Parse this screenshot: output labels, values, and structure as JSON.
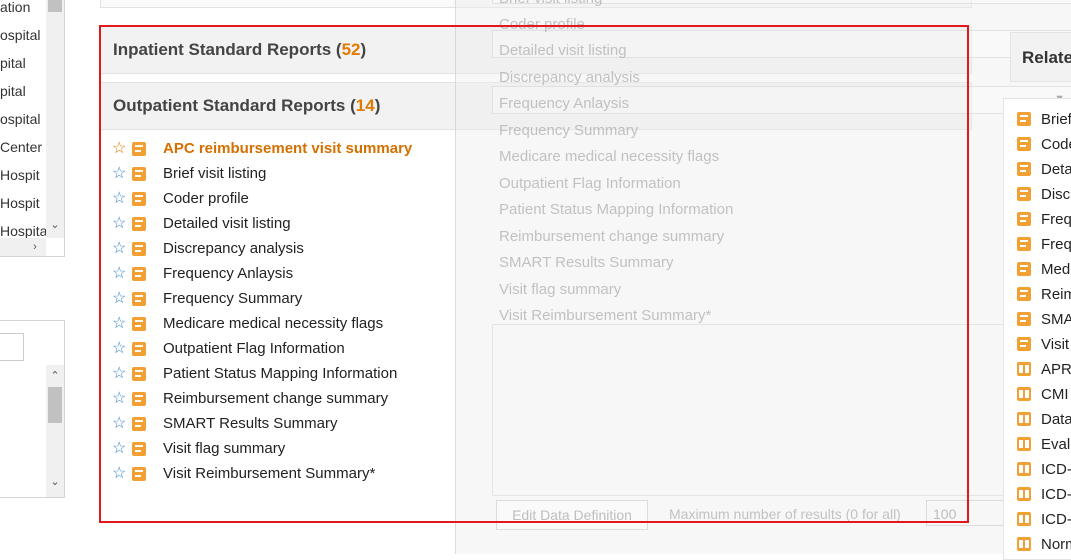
{
  "sidebar": {
    "facility_items": [
      "ation",
      "ospital",
      "pital",
      "pital",
      "ospital",
      "Center",
      "Hospit",
      "Hospit",
      "Hospita"
    ]
  },
  "main": {
    "sections": [
      {
        "label": "Inpatient Standard Reports",
        "count": "52",
        "state": "collapsed"
      },
      {
        "label": "Outpatient Standard Reports",
        "count": "14",
        "state": "expanded"
      }
    ],
    "reports": [
      "APC reimbursement visit summary",
      "Brief visit listing",
      "Coder profile",
      "Detailed visit listing",
      "Discrepancy analysis",
      "Frequency Anlaysis",
      "Frequency Summary",
      "Medicare medical necessity flags",
      "Outpatient Flag Information",
      "Patient Status Mapping Information",
      "Reimbursement change summary",
      "SMART Results Summary",
      "Visit flag summary",
      "Visit Reimbursement Summary*"
    ],
    "selected_index": 0
  },
  "ghost": {
    "items": [
      "Brief visit listing",
      "Coder profile",
      "Detailed visit listing",
      "Discrepancy analysis",
      "Frequency Anlaysis",
      "Frequency Summary",
      "Medicare medical necessity flags",
      "Outpatient Flag Information",
      "Patient Status Mapping Information",
      "Reimbursement change summary",
      "SMART Results Summary",
      "Visit flag summary",
      "Visit Reimbursement Summary*"
    ],
    "edit_button": "Edit Data Definition",
    "max_label": "Maximum number of results (0 for all)",
    "max_value": "100"
  },
  "related": {
    "title": "Relate",
    "items": [
      {
        "label": "Brief",
        "icon": "report-icon"
      },
      {
        "label": "Code",
        "icon": "report-icon"
      },
      {
        "label": "Deta",
        "icon": "report-icon"
      },
      {
        "label": "Disc",
        "icon": "report-icon"
      },
      {
        "label": "Freq",
        "icon": "report-icon"
      },
      {
        "label": "Freq",
        "icon": "report-icon"
      },
      {
        "label": "Medi",
        "icon": "report-icon"
      },
      {
        "label": "Reim",
        "icon": "report-icon"
      },
      {
        "label": "SMA",
        "icon": "report-icon"
      },
      {
        "label": "Visit",
        "icon": "report-icon"
      },
      {
        "label": "APR",
        "icon": "book-icon"
      },
      {
        "label": "CMI",
        "icon": "book-icon"
      },
      {
        "label": "Data",
        "icon": "book-icon"
      },
      {
        "label": "Evalu",
        "icon": "book-icon"
      },
      {
        "label": "ICD-",
        "icon": "book-icon"
      },
      {
        "label": "ICD-",
        "icon": "book-icon"
      },
      {
        "label": "ICD-",
        "icon": "book-icon"
      },
      {
        "label": "Norm",
        "icon": "book-icon"
      }
    ]
  },
  "colors": {
    "accent": "#e07a00",
    "star": "#3b86c6",
    "icon": "#f2a033",
    "highlight": "#e0191d"
  }
}
